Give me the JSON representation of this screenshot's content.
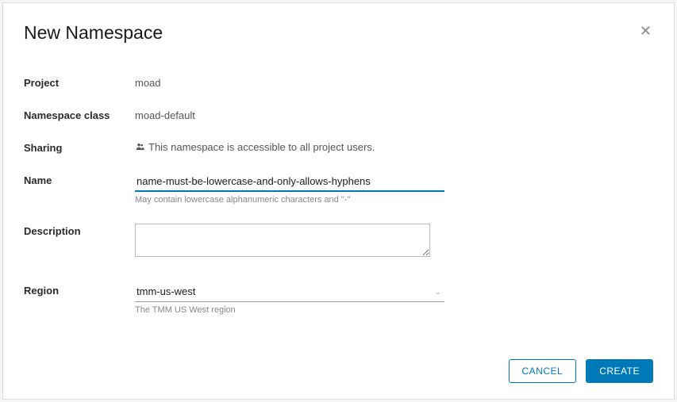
{
  "dialog": {
    "title": "New Namespace",
    "close_label": "✕"
  },
  "form": {
    "project": {
      "label": "Project",
      "value": "moad"
    },
    "namespace_class": {
      "label": "Namespace class",
      "value": "moad-default"
    },
    "sharing": {
      "label": "Sharing",
      "text": "This namespace is accessible to all project users."
    },
    "name": {
      "label": "Name",
      "value": "name-must-be-lowercase-and-only-allows-hyphens",
      "helper": "May contain lowercase alphanumeric characters and \"-\""
    },
    "description": {
      "label": "Description",
      "value": ""
    },
    "region": {
      "label": "Region",
      "selected": "tmm-us-west",
      "helper": "The TMM US West region"
    }
  },
  "footer": {
    "cancel": "CANCEL",
    "create": "CREATE"
  },
  "colors": {
    "accent": "#0079b8"
  }
}
